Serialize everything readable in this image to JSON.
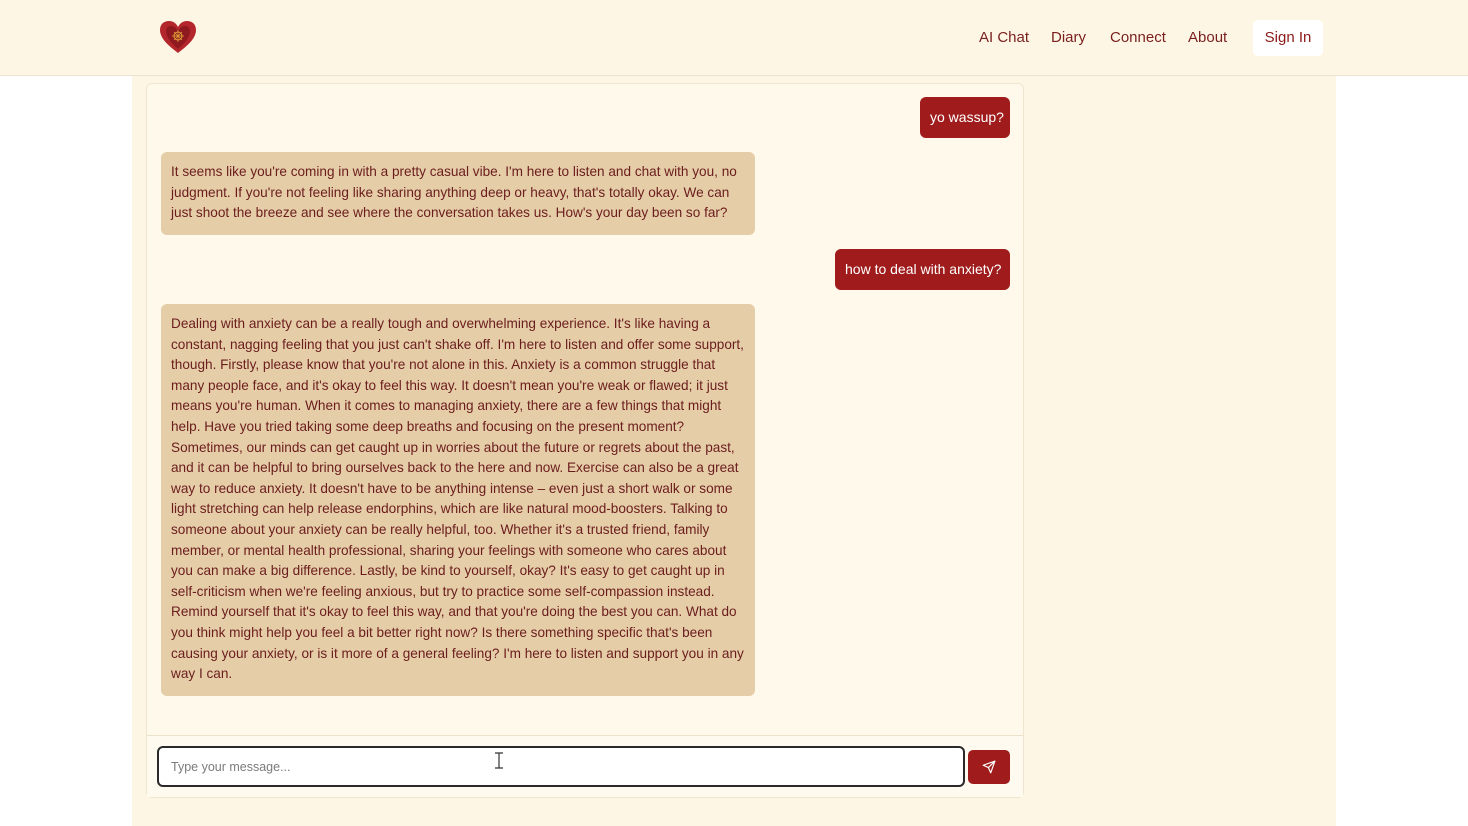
{
  "header": {
    "logo_icon": "heart-logo-icon",
    "nav": [
      {
        "label": "AI Chat"
      },
      {
        "label": "Diary"
      },
      {
        "label": "Connect"
      },
      {
        "label": "About"
      }
    ],
    "signin_label": "Sign In"
  },
  "chat": {
    "messages": [
      {
        "role": "user",
        "text": "yo wassup?"
      },
      {
        "role": "assistant",
        "text": "It seems like you're coming in with a pretty casual vibe. I'm here to listen and chat with you, no judgment. If you're not feeling like sharing anything deep or heavy, that's totally okay. We can just shoot the breeze and see where the conversation takes us. How's your day been so far?"
      },
      {
        "role": "user",
        "text": "how to deal with anxiety?"
      },
      {
        "role": "assistant",
        "text": "Dealing with anxiety can be a really tough and overwhelming experience. It's like having a constant, nagging feeling that you just can't shake off. I'm here to listen and offer some support, though. Firstly, please know that you're not alone in this. Anxiety is a common struggle that many people face, and it's okay to feel this way. It doesn't mean you're weak or flawed; it just means you're human. When it comes to managing anxiety, there are a few things that might help. Have you tried taking some deep breaths and focusing on the present moment? Sometimes, our minds can get caught up in worries about the future or regrets about the past, and it can be helpful to bring ourselves back to the here and now. Exercise can also be a great way to reduce anxiety. It doesn't have to be anything intense – even just a short walk or some light stretching can help release endorphins, which are like natural mood-boosters. Talking to someone about your anxiety can be really helpful, too. Whether it's a trusted friend, family member, or mental health professional, sharing your feelings with someone who cares about you can make a big difference. Lastly, be kind to yourself, okay? It's easy to get caught up in self-criticism when we're feeling anxious, but try to practice some self-compassion instead. Remind yourself that it's okay to feel this way, and that you're doing the best you can. What do you think might help you feel a bit better right now? Is there something specific that's been causing your anxiety, or is it more of a general feeling? I'm here to listen and support you in any way I can."
      }
    ]
  },
  "composer": {
    "value": "",
    "placeholder": "Type your message...",
    "send_icon": "send-icon"
  },
  "colors": {
    "accent": "#a01c1c",
    "background": "#fdf6e4",
    "assistant_bubble": "#e5cda8",
    "nav_text": "#7a1f1f"
  }
}
